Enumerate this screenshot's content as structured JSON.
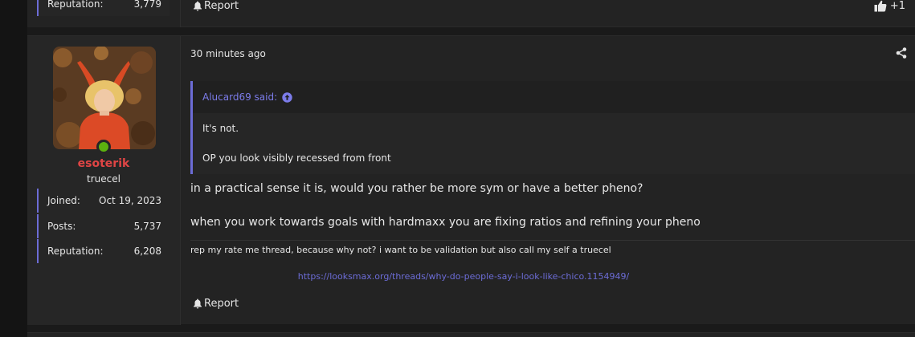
{
  "previous_post": {
    "reputation_label": "Reputation:",
    "reputation_value": "3,779",
    "report_label": "Report",
    "like_count": "+1"
  },
  "post": {
    "time": "30 minutes ago",
    "user": {
      "name": "esoterik",
      "title": "truecel",
      "online": true,
      "stats": [
        {
          "label": "Joined:",
          "value": "Oct 19, 2023"
        },
        {
          "label": "Posts:",
          "value": "5,737"
        },
        {
          "label": "Reputation:",
          "value": "6,208"
        }
      ]
    },
    "quote": {
      "author": "Alucard69 said:",
      "lines": [
        "It's not.",
        "OP you look visibly recessed from front"
      ]
    },
    "body": [
      "in a practical sense it is, would you rather be more sym or have a better pheno?",
      "when you work towards goals with hardmaxx you are fixing ratios and refining your pheno"
    ],
    "signature": {
      "text": "rep my rate me thread, because why not? i want to be validation but also call my self a truecel",
      "link": "https://looksmax.org/threads/why-do-people-say-i-look-like-chico.1154949/"
    },
    "report_label": "Report"
  },
  "colors": {
    "accent": "#6c6cd6",
    "username": "#e04545",
    "online": "#5cb20f"
  }
}
